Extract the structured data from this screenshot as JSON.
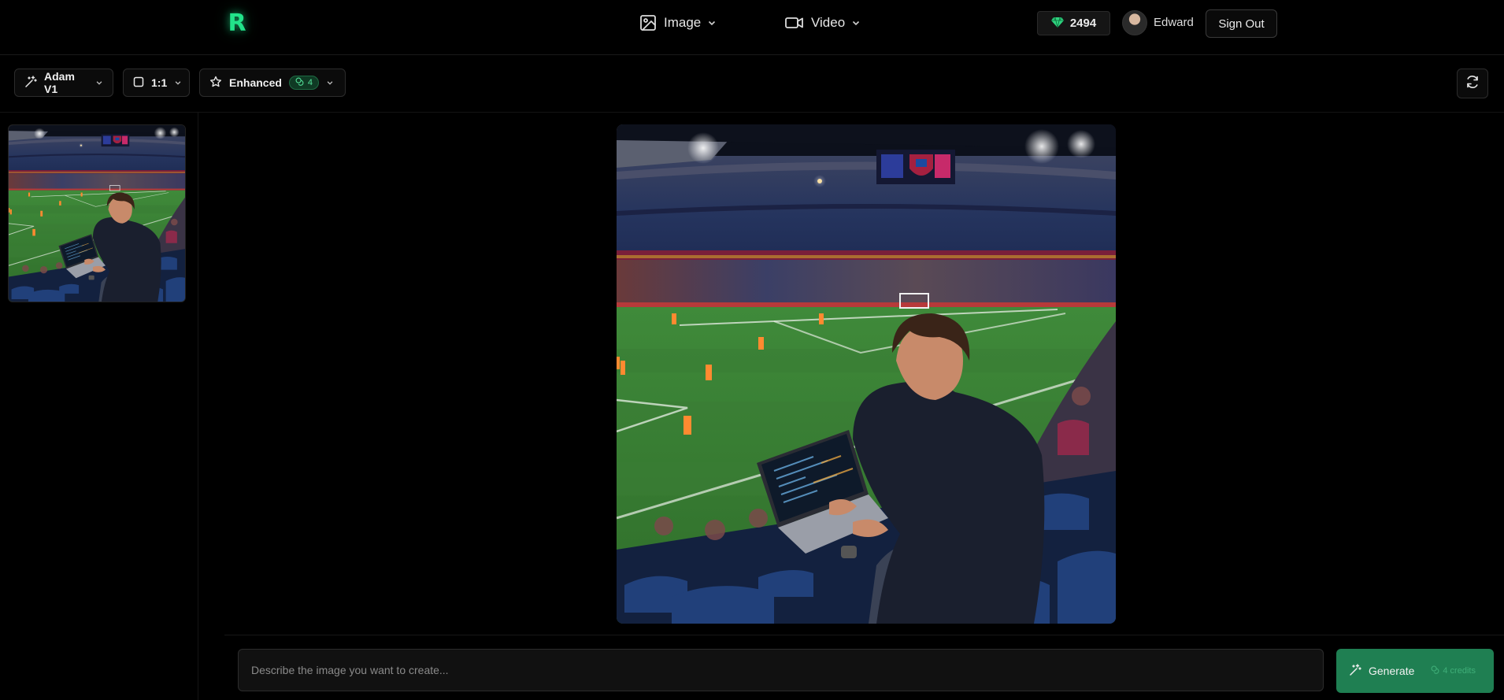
{
  "header": {
    "logo": "R",
    "nav": [
      {
        "label": "Image",
        "icon": "image-icon"
      },
      {
        "label": "Video",
        "icon": "video-icon"
      }
    ],
    "credits": "2494",
    "user_name": "Edward",
    "sign_out_label": "Sign Out"
  },
  "toolbar": {
    "model_label": "Adam V1",
    "ratio_label": "1:1",
    "quality_label": "Enhanced",
    "quality_cost": "4"
  },
  "prompt": {
    "placeholder": "Describe the image you want to create...",
    "value": ""
  },
  "generate": {
    "label": "Generate",
    "credits_label": "4 credits"
  },
  "colors": {
    "accent": "#22e38a",
    "generate_bg": "#1f7f52",
    "background": "#000000"
  }
}
